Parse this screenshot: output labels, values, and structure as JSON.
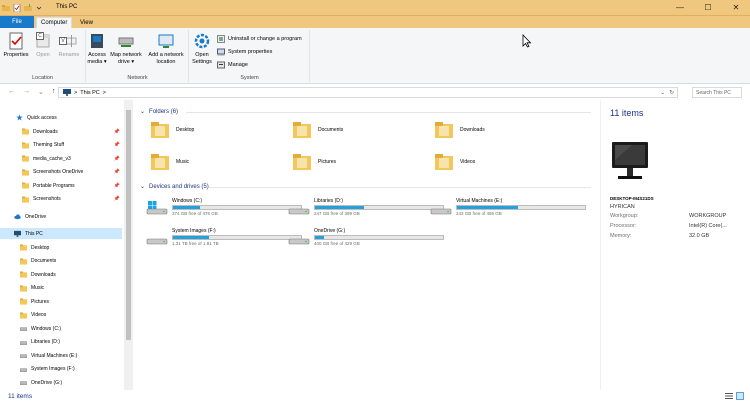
{
  "window": {
    "title": "This PC",
    "minimize": "—",
    "maximize": "☐",
    "close": "✕"
  },
  "ribbon_tabs": {
    "file": "File",
    "computer": "Computer",
    "view": "View",
    "keytips": {
      "computer": "C",
      "view": "V"
    }
  },
  "location_group": {
    "label": "Location",
    "properties": "Properties",
    "open": "Open",
    "rename": "Rename"
  },
  "network_group": {
    "label": "Network",
    "access_media": "Access media ▾",
    "map_drive": "Map network drive ▾",
    "add_location": "Add a network location"
  },
  "system_group": {
    "label": "System",
    "open_settings": "Open Settings",
    "uninstall": "Uninstall or change a program",
    "system_properties": "System properties",
    "manage": "Manage"
  },
  "address": {
    "back": "←",
    "forward": "→",
    "dropdown": "⌄",
    "up": "↑",
    "path_sep": ">",
    "path": "This PC",
    "path_end": ">",
    "refresh": "↻",
    "search_placeholder": "Search This PC"
  },
  "nav": {
    "quick_access": "Quick access",
    "quick_items": [
      "Downloads",
      "Theming Stuff",
      "media_cache_v3",
      "Screenshots OneDrive",
      "Portable Programs",
      "Screenshots"
    ],
    "onedrive": "OneDrive",
    "this_pc": "This PC",
    "pc_items": [
      "Desktop",
      "Documents",
      "Downloads",
      "Music",
      "Pictures",
      "Videos",
      "Windows (C:)",
      "Libraries (D:)",
      "Virtual Machines (E:)",
      "System Images (F:)",
      "OneDrive (G:)"
    ]
  },
  "folders": {
    "heading": "Folders (6)",
    "items": [
      "Desktop",
      "Documents",
      "Downloads",
      "Music",
      "Pictures",
      "Videos"
    ]
  },
  "drives": {
    "heading": "Devices and drives (5)",
    "items": [
      {
        "name": "Windows (C:)",
        "space": "374 GB free of 476 GB",
        "used_fraction": 0.21
      },
      {
        "name": "Libraries (D:)",
        "space": "247 GB free of 399 GB",
        "used_fraction": 0.38
      },
      {
        "name": "Virtual Machines (E:)",
        "space": "243 GB free of 465 GB",
        "used_fraction": 0.48
      },
      {
        "name": "System Images (F:)",
        "space": "1.31 TB free of 1.81 TB",
        "used_fraction": 0.28
      },
      {
        "name": "OneDrive (G:)",
        "space": "400 GB free of 429 GB",
        "used_fraction": 0.07
      }
    ]
  },
  "details": {
    "count": "11 items",
    "computer_name": "DESKTOP-M4S21DS",
    "owner": "HYRICAN",
    "workgroup_label": "Workgroup:",
    "workgroup": "WORKGROUP",
    "processor_label": "Processor:",
    "processor": "Intel(R) Core(...",
    "memory_label": "Memory:",
    "memory": "32.0 GB"
  },
  "status": {
    "items": "11 items"
  },
  "colors": {
    "titlebar": "#f0c77e",
    "accent": "#1979ca",
    "drive_bar": "#26a0da",
    "header_text": "#1e3287"
  }
}
